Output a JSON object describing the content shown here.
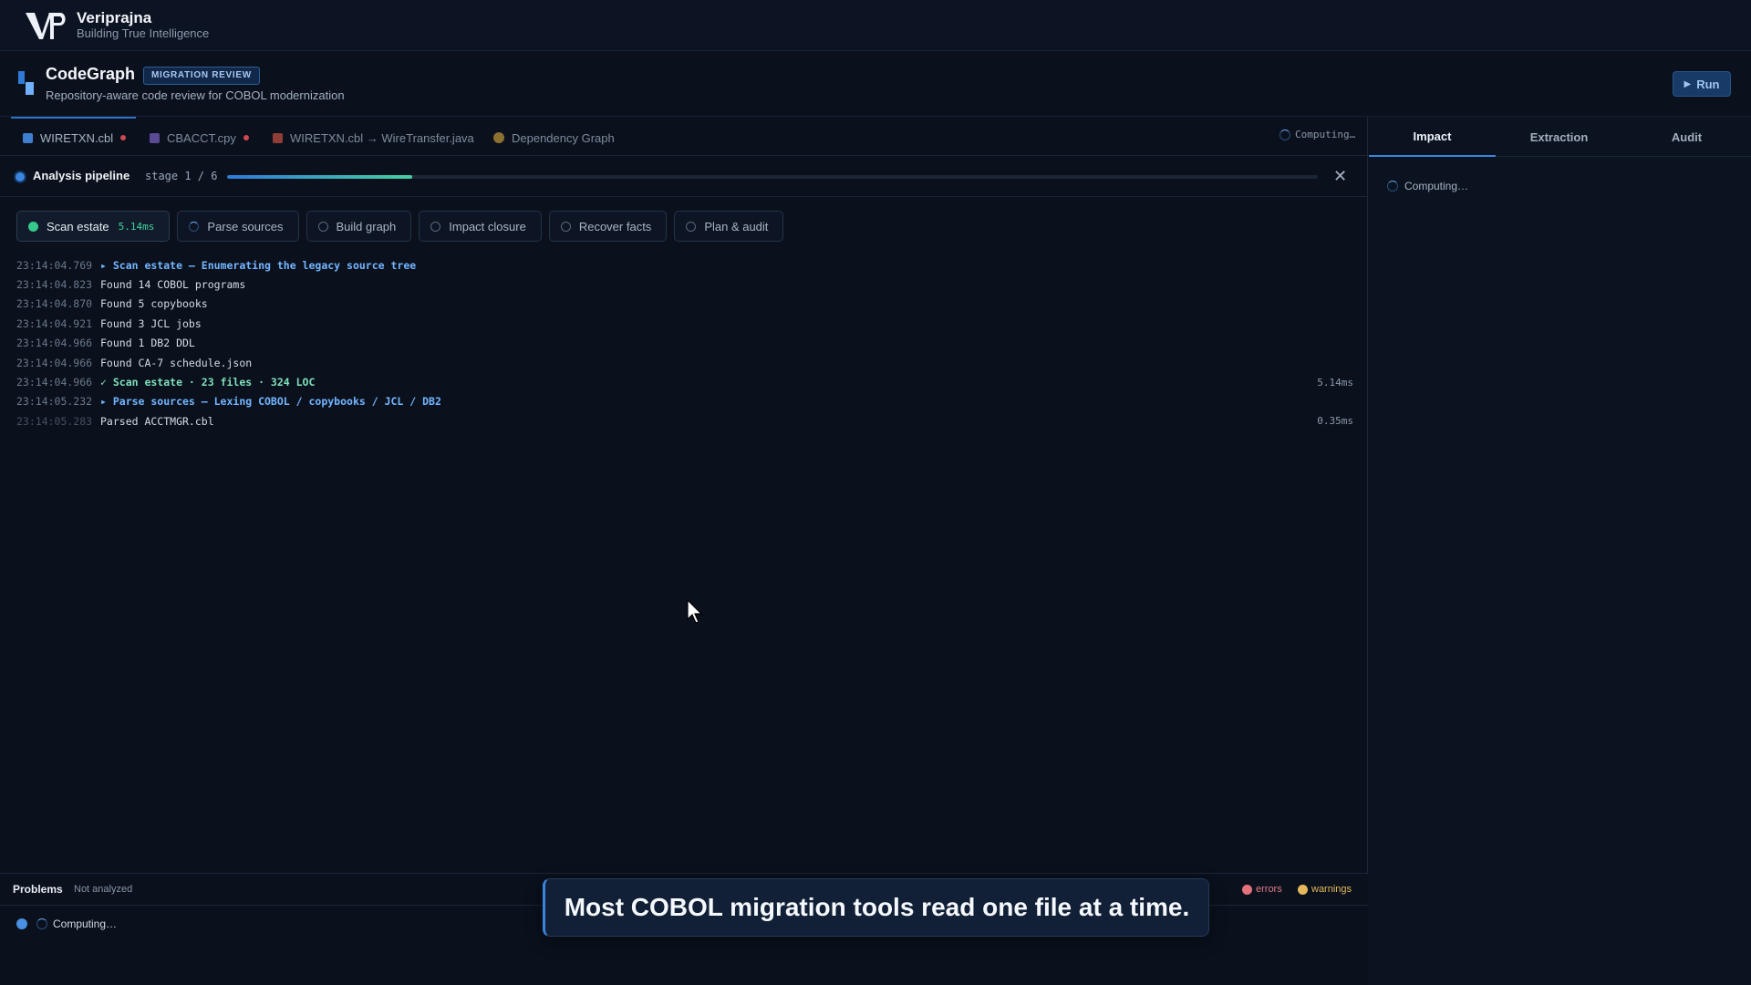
{
  "brand": {
    "name": "Veriprajna",
    "tagline": "Building True Intelligence"
  },
  "app": {
    "title": "CodeGraph",
    "badge": "MIGRATION REVIEW",
    "subtitle": "Repository-aware code review for COBOL modernization",
    "run_label": "Run"
  },
  "tabs": [
    {
      "label": "WIRETXN.cbl",
      "color": "#3f7fd0",
      "modified": true
    },
    {
      "label": "CBACCT.cpy",
      "color": "#7a5fc4",
      "modified": true
    },
    {
      "label": "WIRETXN.cbl → WireTransfer.java",
      "color": "#b84f3f",
      "modified": false
    },
    {
      "label": "Dependency Graph",
      "color": "#c8a035",
      "modified": false
    }
  ],
  "tab_status": "Computing…",
  "pipeline": {
    "title": "Analysis pipeline",
    "stage_text": "stage 1 / 6",
    "progress": 0.17
  },
  "stages": [
    {
      "label": "Scan estate",
      "time": "5.14ms",
      "state": "done"
    },
    {
      "label": "Parse sources",
      "state": "running"
    },
    {
      "label": "Build graph",
      "state": "pending"
    },
    {
      "label": "Impact closure",
      "state": "pending"
    },
    {
      "label": "Recover facts",
      "state": "pending"
    },
    {
      "label": "Plan & audit",
      "state": "pending"
    }
  ],
  "log": [
    {
      "time": "23:14:04.769",
      "msg": "▸ Scan estate — Enumerating the legacy source tree",
      "kind": "head",
      "dur": ""
    },
    {
      "time": "23:14:04.823",
      "msg": "Found 14 COBOL programs",
      "kind": "",
      "dur": ""
    },
    {
      "time": "23:14:04.870",
      "msg": "Found 5 copybooks",
      "kind": "",
      "dur": ""
    },
    {
      "time": "23:14:04.921",
      "msg": "Found 3 JCL jobs",
      "kind": "",
      "dur": ""
    },
    {
      "time": "23:14:04.966",
      "msg": "Found 1 DB2 DDL",
      "kind": "",
      "dur": ""
    },
    {
      "time": "23:14:04.966",
      "msg": "Found CA-7 schedule.json",
      "kind": "",
      "dur": ""
    },
    {
      "time": "23:14:04.966",
      "msg": "✓ Scan estate · 23 files · 324 LOC",
      "kind": "ok",
      "dur": "5.14ms"
    },
    {
      "time": "23:14:05.232",
      "msg": "▸ Parse sources — Lexing COBOL / copybooks / JCL / DB2",
      "kind": "head",
      "dur": ""
    },
    {
      "time": "23:14:05.283",
      "msg": "Parsed ACCTMGR.cbl",
      "kind": "fade",
      "dur": "0.35ms"
    }
  ],
  "problems": {
    "tab": "Problems",
    "status": "Not analyzed",
    "errors_label": "errors",
    "warnings_label": "warnings",
    "body": "Computing…"
  },
  "caption": "Most COBOL migration tools read one file at a time.",
  "right": {
    "tabs": [
      "Impact",
      "Extraction",
      "Audit"
    ],
    "active": "Impact",
    "status": "Computing…"
  },
  "colors": {
    "accent": "#3b84dd",
    "success": "#35c98c",
    "error": "#e5717c",
    "warning": "#e5b85c"
  }
}
